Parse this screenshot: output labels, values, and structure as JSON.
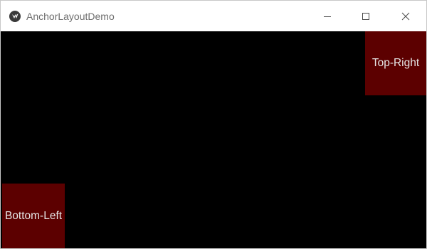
{
  "window": {
    "title": "AnchorLayoutDemo",
    "app_icon": "kivy-icon",
    "controls": {
      "minimize": "minimize-icon",
      "maximize": "maximize-icon",
      "close": "close-icon"
    }
  },
  "canvas": {
    "background": "#000000",
    "buttons": {
      "top_right": {
        "label": "Top-Right",
        "color": "#5c0000"
      },
      "bottom_left": {
        "label": "Bottom-Left",
        "color": "#5c0000"
      }
    }
  }
}
